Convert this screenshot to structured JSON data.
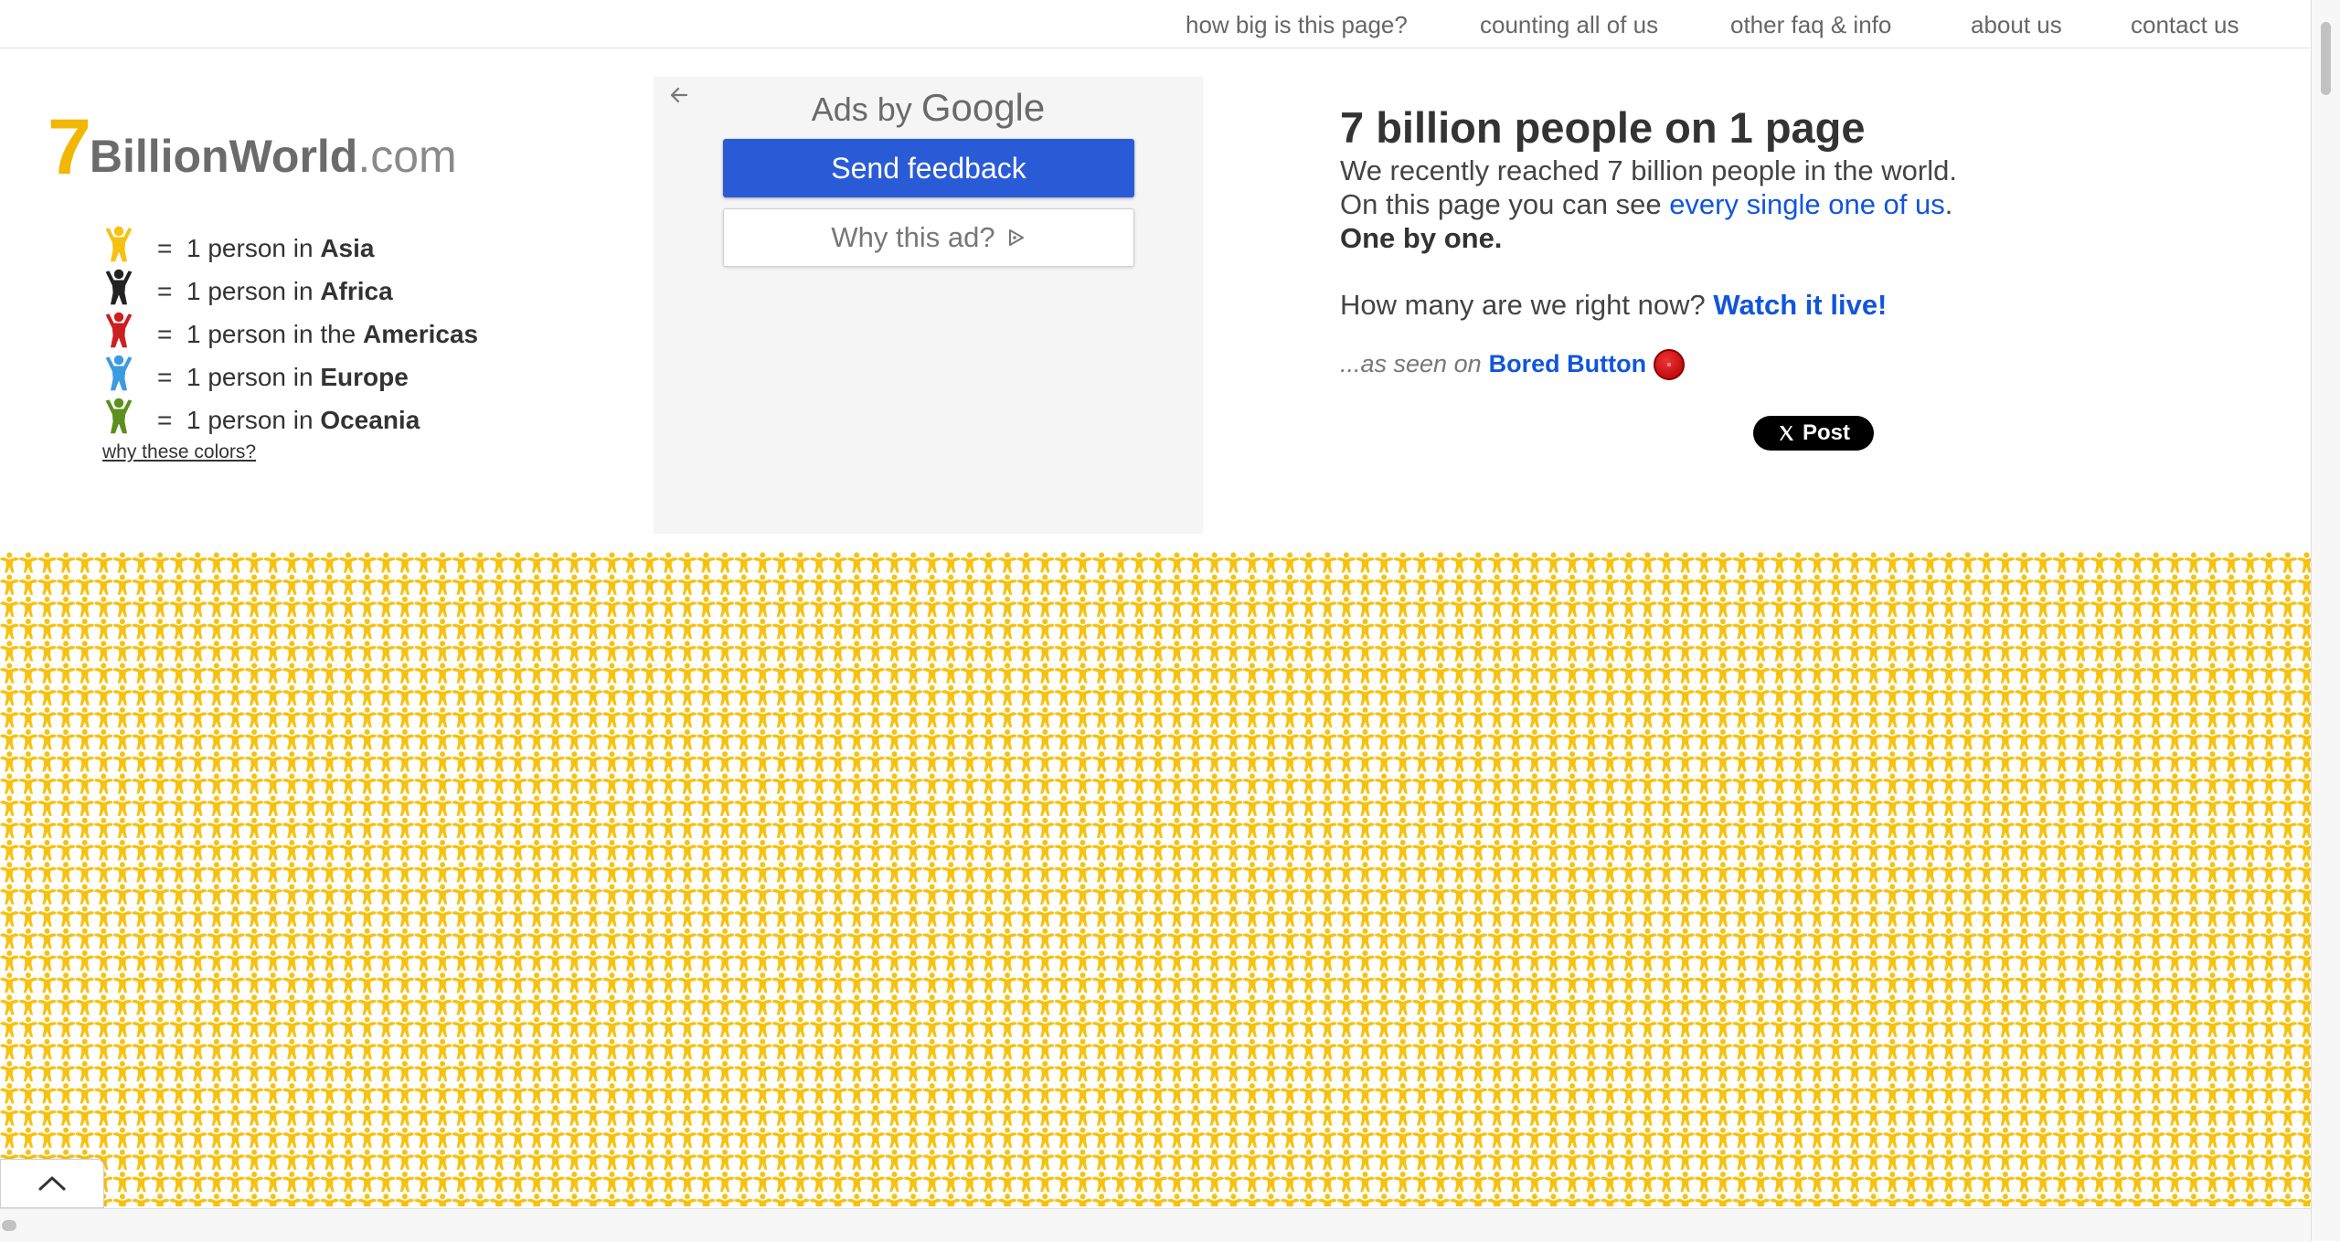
{
  "nav": {
    "items": [
      "how big is this page?",
      "counting all of us",
      "other faq & info",
      "about us",
      "contact us"
    ]
  },
  "logo": {
    "seven": "7",
    "billion": "Billion",
    "world": "World",
    "dotcom": ".com"
  },
  "legend": {
    "rows": [
      {
        "eq": "=",
        "prefix": "1 person in ",
        "region": "Asia",
        "color": "#f6c10f"
      },
      {
        "eq": "=",
        "prefix": "1 person in ",
        "region": "Africa",
        "color": "#222222"
      },
      {
        "eq": "=",
        "prefix": "1 person in the ",
        "region": "Americas",
        "color": "#cc1f1f"
      },
      {
        "eq": "=",
        "prefix": "1 person in ",
        "region": "Europe",
        "color": "#3b9be0"
      },
      {
        "eq": "=",
        "prefix": "1 person in ",
        "region": "Oceania",
        "color": "#5c8f1d"
      }
    ],
    "why_link": "why these colors?"
  },
  "ad": {
    "back_icon": "arrow-left-icon",
    "ads_by": "Ads by",
    "google": "Google",
    "feedback": "Send feedback",
    "why": "Why this ad?",
    "why_icon": "adchoices-triangle-icon"
  },
  "intro": {
    "title": "7 billion people on 1 page",
    "line1": "We recently reached 7 billion people in the world.",
    "line2_prefix": "On this page you can see ",
    "line2_link": "every single one of us",
    "line2_suffix": ".",
    "line3": "One by one.",
    "question": "How many are we right now? ",
    "watch_link": "Watch it live!",
    "seen_prefix": "...as seen on ",
    "seen_link": "Bored Button",
    "seen_icon": "red-button-icon"
  },
  "share": {
    "icon": "x-logo-icon",
    "label": "Post"
  },
  "people_grid": {
    "color": "#f6c10f",
    "figure": "person-icon"
  },
  "scroll_top": {
    "icon": "chevron-up-icon"
  }
}
